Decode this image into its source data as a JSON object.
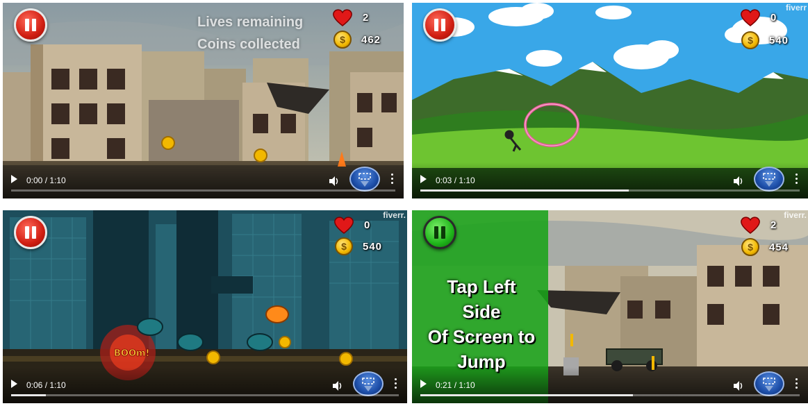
{
  "panels": [
    {
      "overlay_labels": [
        "Lives remaining",
        "Coins collected"
      ],
      "lives": "2",
      "coins": "462",
      "time": "0:00 / 1:10",
      "progress": 0.0,
      "pause_color": "red"
    },
    {
      "watermark": "fiverr",
      "lives": "0",
      "coins": "540",
      "time": "0:03 / 1:10",
      "progress": 0.55,
      "pause_color": "red"
    },
    {
      "watermark": "fiverr.",
      "lives": "0",
      "coins": "540",
      "time": "0:06 / 1:10",
      "progress": 0.09,
      "explosion_text": "BOOm!",
      "pause_color": "red"
    },
    {
      "watermark": "fiverr.",
      "lives": "2",
      "coins": "454",
      "time": "0:21 / 1:10",
      "progress": 0.56,
      "tap_instruction": [
        "Tap Left Side",
        "Of Screen to",
        "Jump"
      ],
      "pause_color": "green"
    }
  ],
  "icons": {
    "pause": "pause-icon",
    "lives": "heart-icon",
    "coins": "coin-icon",
    "coin_symbol": "$",
    "play": "play-icon",
    "volume": "volume-icon",
    "jump": "jump-icon",
    "more": "more-vert-icon"
  },
  "colors": {
    "pause_red": "#d01e12",
    "pause_green": "#1fb51a",
    "heart": "#e01818",
    "coin": "#f2b800",
    "jump_button": "#1d4ea8",
    "tap_overlay": "#1aa31a"
  }
}
